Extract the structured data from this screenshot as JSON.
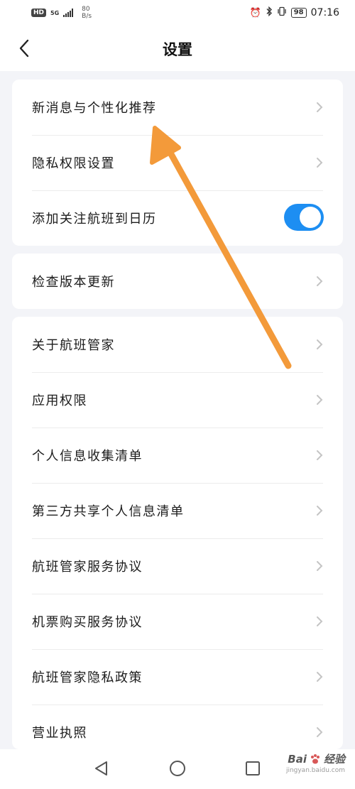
{
  "status_bar": {
    "hd": "HD",
    "network": "5G",
    "speed_value": "80",
    "speed_unit": "B/s",
    "battery": "98",
    "time": "07:16"
  },
  "header": {
    "title": "设置"
  },
  "group1": {
    "items": [
      {
        "label": "新消息与个性化推荐"
      },
      {
        "label": "隐私权限设置"
      },
      {
        "label": "添加关注航班到日历",
        "toggle_on": true
      }
    ]
  },
  "group2": {
    "items": [
      {
        "label": "检查版本更新"
      }
    ]
  },
  "group3": {
    "items": [
      {
        "label": "关于航班管家"
      },
      {
        "label": "应用权限"
      },
      {
        "label": "个人信息收集清单"
      },
      {
        "label": "第三方共享个人信息清单"
      },
      {
        "label": "航班管家服务协议"
      },
      {
        "label": "机票购买服务协议"
      },
      {
        "label": "航班管家隐私政策"
      },
      {
        "label": "营业执照"
      }
    ]
  },
  "watermark": {
    "brand": "Bai",
    "brand_suffix": "经验",
    "url": "jingyan.baidu.com"
  },
  "colors": {
    "accent": "#1d8ef2",
    "annotation_arrow": "#f39a3a"
  }
}
